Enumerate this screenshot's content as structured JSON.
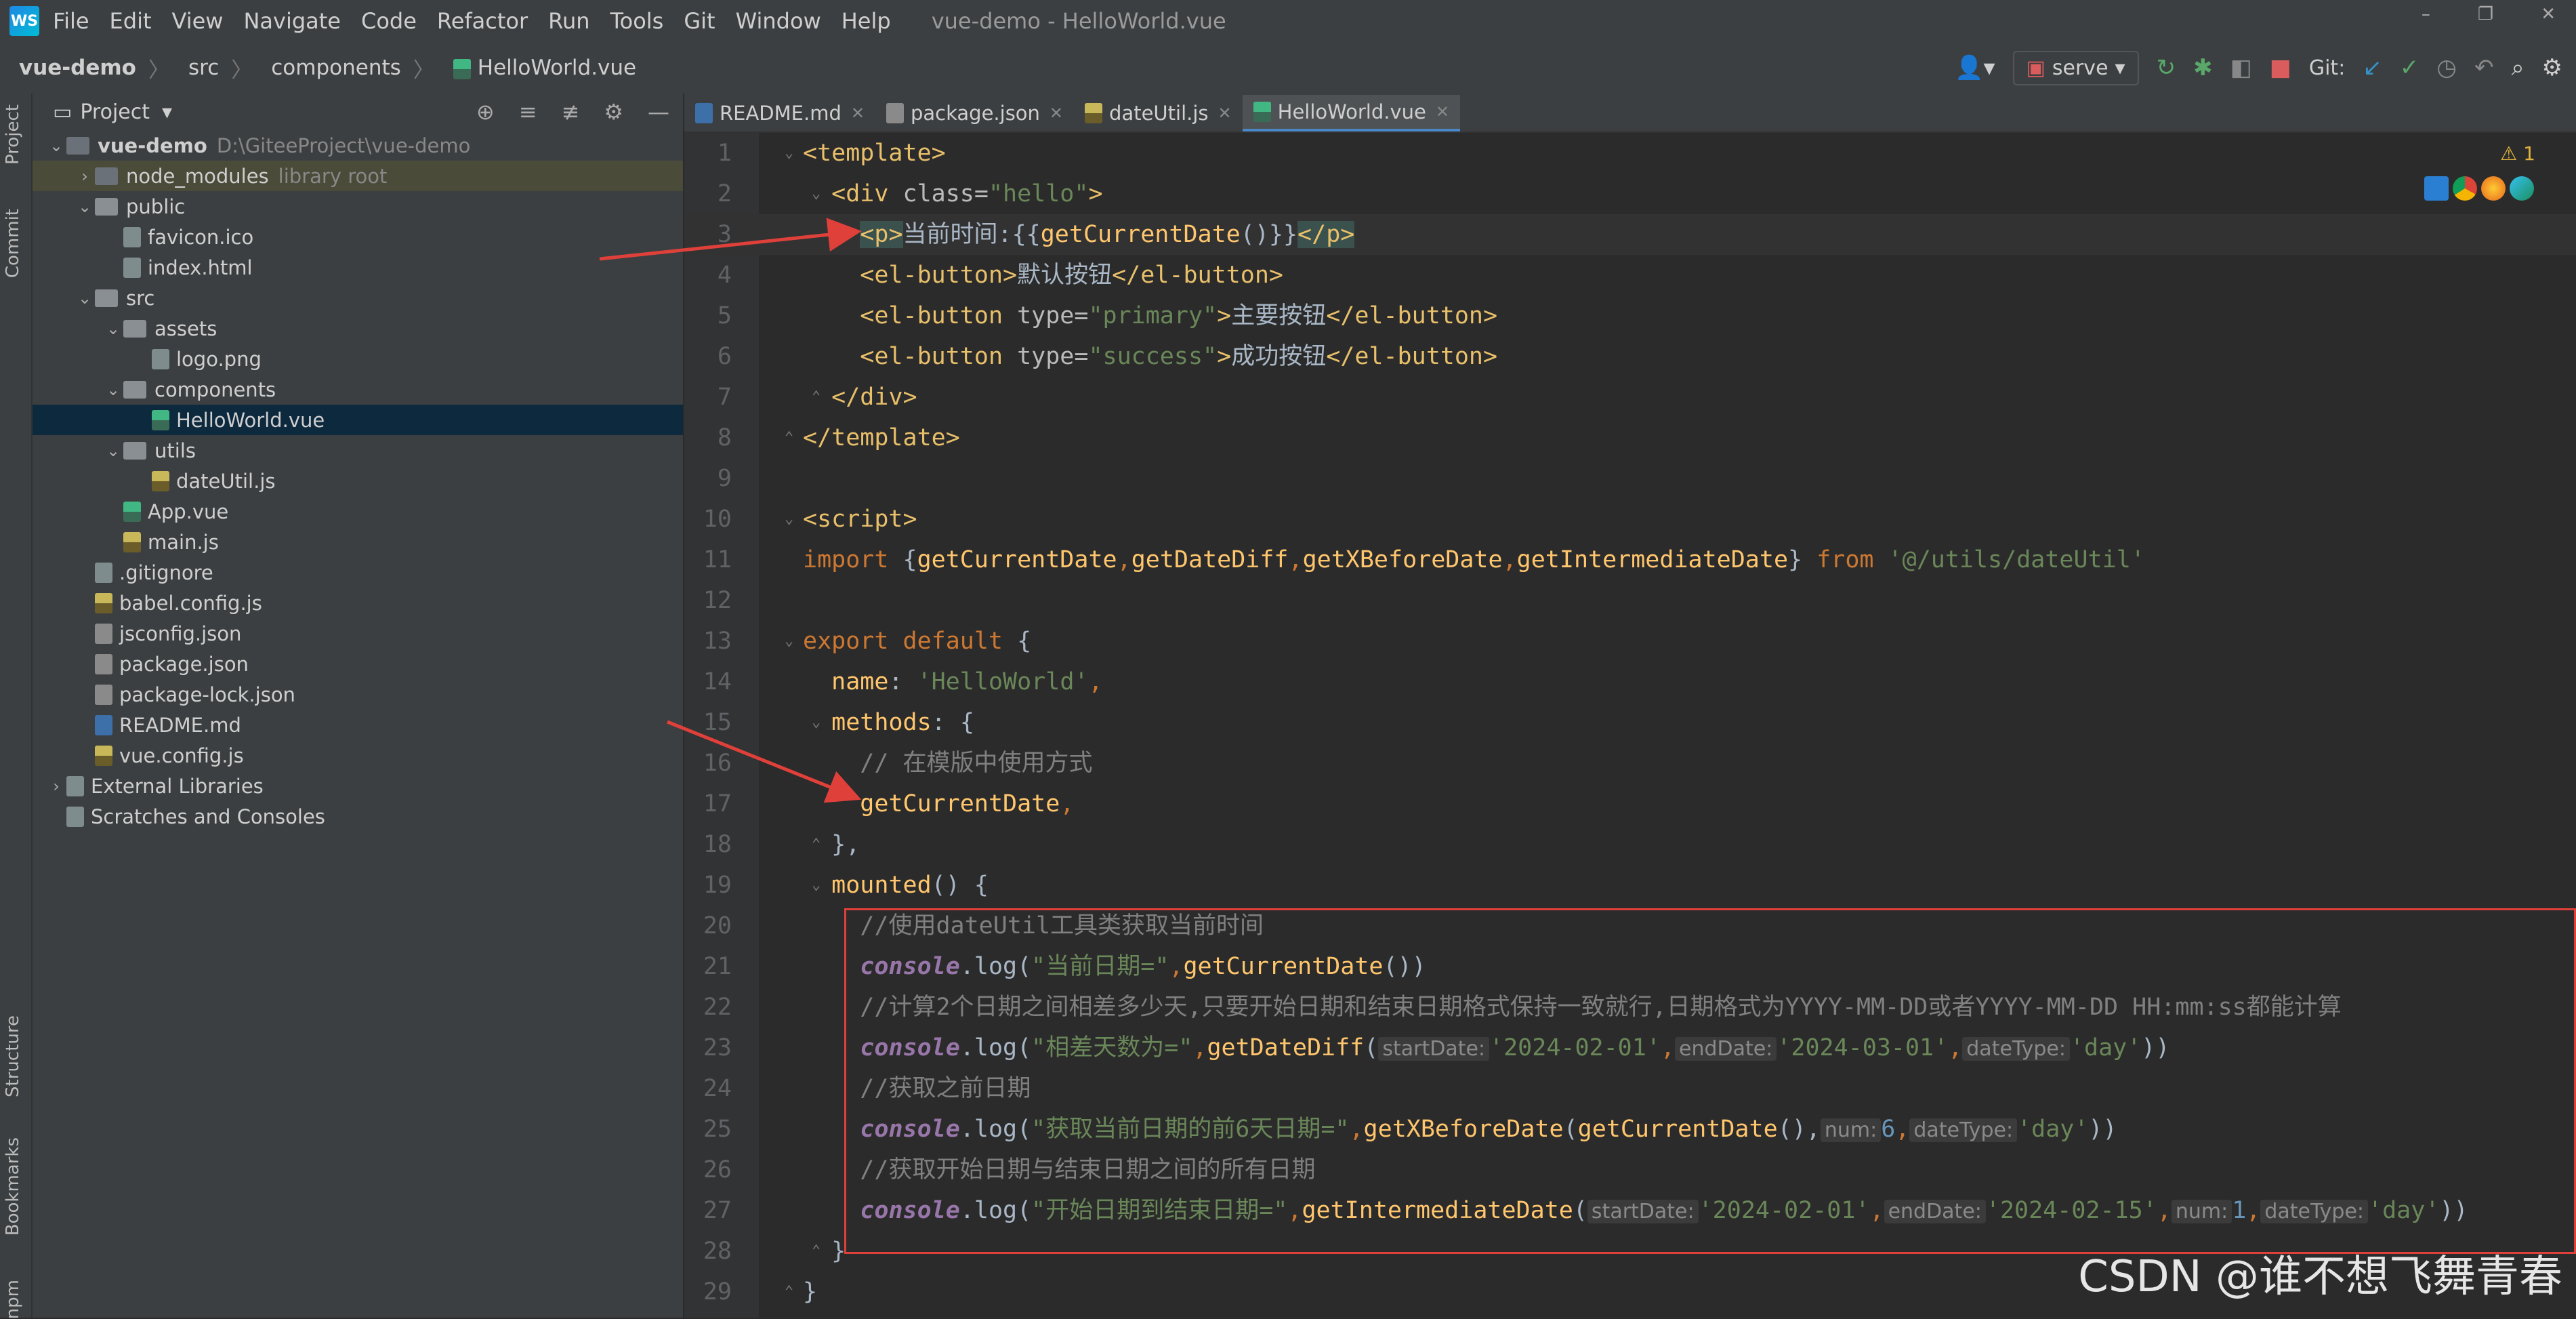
{
  "menubar": {
    "logo": "WS",
    "items": [
      "File",
      "Edit",
      "View",
      "Navigate",
      "Code",
      "Refactor",
      "Run",
      "Tools",
      "Git",
      "Window",
      "Help"
    ],
    "window_title": "vue-demo - HelloWorld.vue"
  },
  "breadcrumb": {
    "project": "vue-demo",
    "src": "src",
    "components": "components",
    "file": "HelloWorld.vue"
  },
  "toolbar": {
    "run_config": "serve",
    "git_label": "Git:"
  },
  "left_strip": {
    "project": "Project",
    "commit": "Commit",
    "structure": "Structure",
    "bookmarks": "Bookmarks",
    "npm": "npm"
  },
  "project_panel": {
    "title": "Project",
    "tree": [
      {
        "label": "vue-demo",
        "path": "D:\\GiteeProject\\vue-demo",
        "indent": 0,
        "arrow": "v",
        "type": "folder-dark",
        "bold": true
      },
      {
        "label": "node_modules",
        "path": "library root",
        "indent": 1,
        "arrow": ">",
        "type": "folder-dark"
      },
      {
        "label": "public",
        "indent": 1,
        "arrow": "v",
        "type": "folder"
      },
      {
        "label": "favicon.ico",
        "indent": 2,
        "type": "plain"
      },
      {
        "label": "index.html",
        "indent": 2,
        "type": "plain"
      },
      {
        "label": "src",
        "indent": 1,
        "arrow": "v",
        "type": "folder"
      },
      {
        "label": "assets",
        "indent": 2,
        "arrow": "v",
        "type": "folder"
      },
      {
        "label": "logo.png",
        "indent": 3,
        "type": "plain"
      },
      {
        "label": "components",
        "indent": 2,
        "arrow": "v",
        "type": "folder"
      },
      {
        "label": "HelloWorld.vue",
        "indent": 3,
        "type": "vue",
        "selected": true
      },
      {
        "label": "utils",
        "indent": 2,
        "arrow": "v",
        "type": "folder"
      },
      {
        "label": "dateUtil.js",
        "indent": 3,
        "type": "js"
      },
      {
        "label": "App.vue",
        "indent": 2,
        "type": "vue"
      },
      {
        "label": "main.js",
        "indent": 2,
        "type": "js"
      },
      {
        "label": ".gitignore",
        "indent": 1,
        "type": "plain"
      },
      {
        "label": "babel.config.js",
        "indent": 1,
        "type": "js"
      },
      {
        "label": "jsconfig.json",
        "indent": 1,
        "type": "json"
      },
      {
        "label": "package.json",
        "indent": 1,
        "type": "json"
      },
      {
        "label": "package-lock.json",
        "indent": 1,
        "type": "json"
      },
      {
        "label": "README.md",
        "indent": 1,
        "type": "md"
      },
      {
        "label": "vue.config.js",
        "indent": 1,
        "type": "js"
      },
      {
        "label": "External Libraries",
        "indent": 0,
        "arrow": ">",
        "type": "lib"
      },
      {
        "label": "Scratches and Consoles",
        "indent": 0,
        "arrow": "",
        "type": "lib"
      }
    ]
  },
  "tabs": [
    {
      "label": "README.md",
      "type": "md"
    },
    {
      "label": "package.json",
      "type": "json"
    },
    {
      "label": "dateUtil.js",
      "type": "js"
    },
    {
      "label": "HelloWorld.vue",
      "type": "vue",
      "active": true
    }
  ],
  "editor": {
    "warning": "⚠ 1",
    "line_numbers": [
      "1",
      "2",
      "3",
      "4",
      "5",
      "6",
      "7",
      "8",
      "9",
      "10",
      "11",
      "12",
      "13",
      "14",
      "15",
      "16",
      "17",
      "18",
      "19",
      "20",
      "21",
      "22",
      "23",
      "24",
      "25",
      "26",
      "27",
      "28",
      "29"
    ],
    "lines": {
      "l1": "<template>",
      "l2a": "<div ",
      "l2b": "class=",
      "l2c": "\"hello\"",
      "l2d": ">",
      "l3a": "<p>",
      "l3b": "当前时间:{{",
      "l3c": "getCurrentDate",
      "l3d": "()}}",
      "l3e": "</p>",
      "l4a": "<el-button>",
      "l4b": "默认按钮",
      "l4c": "</el-button>",
      "l5a": "<el-button ",
      "l5b": "type=",
      "l5c": "\"primary\"",
      "l5d": ">",
      "l5e": "主要按钮",
      "l5f": "</el-button>",
      "l6a": "<el-button ",
      "l6b": "type=",
      "l6c": "\"success\"",
      "l6d": ">",
      "l6e": "成功按钮",
      "l6f": "</el-button>",
      "l7": "</div>",
      "l8": "</template>",
      "l10": "<script>",
      "l11a": "import ",
      "l11b": "{",
      "l11c": "getCurrentDate",
      "l11d": ",",
      "l11e": "getDateDiff",
      "l11f": ",",
      "l11g": "getXBeforeDate",
      "l11h": ",",
      "l11i": "getIntermediateDate",
      "l11j": "} ",
      "l11k": "from ",
      "l11l": "'@/utils/dateUtil'",
      "l13a": "export default ",
      "l13b": "{",
      "l14a": "name",
      "l14b": ": ",
      "l14c": "'HelloWorld'",
      "l14d": ",",
      "l15a": "methods",
      "l15b": ": {",
      "l16": "// 在模版中使用方式",
      "l17a": "getCurrentDate",
      "l17b": ",",
      "l18": "},",
      "l19a": "mounted",
      "l19b": "() {",
      "l20": "//使用dateUtil工具类获取当前时间",
      "l21a": "console",
      "l21b": ".log(",
      "l21c": "\"当前日期=\"",
      "l21d": ",",
      "l21e": "getCurrentDate",
      "l21f": "())",
      "l22": "//计算2个日期之间相差多少天,只要开始日期和结束日期格式保持一致就行,日期格式为YYYY-MM-DD或者YYYY-MM-DD HH:mm:ss都能计算",
      "l23a": "console",
      "l23b": ".log(",
      "l23c": "\"相差天数为=\"",
      "l23d": ",",
      "l23e": "getDateDiff",
      "l23f": "(",
      "l23h1": "startDate:",
      "l23g": "'2024-02-01'",
      "l23i": ",",
      "l23h2": "endDate:",
      "l23j": "'2024-03-01'",
      "l23k": ",",
      "l23h3": "dateType:",
      "l23l": "'day'",
      "l23m": "))",
      "l24": "//获取之前日期",
      "l25a": "console",
      "l25b": ".log(",
      "l25c": "\"获取当前日期的前6天日期=\"",
      "l25d": ",",
      "l25e": "getXBeforeDate",
      "l25f": "(",
      "l25g": "getCurrentDate",
      "l25h": "(),",
      "l25i1": "num:",
      "l25j": "6",
      "l25k": ",",
      "l25i2": "dateType:",
      "l25l": "'day'",
      "l25m": "))",
      "l26": "//获取开始日期与结束日期之间的所有日期",
      "l27a": "console",
      "l27b": ".log(",
      "l27c": "\"开始日期到结束日期=\"",
      "l27d": ",",
      "l27e": "getIntermediateDate",
      "l27f": "(",
      "l27h1": "startDate:",
      "l27g": "'2024-02-01'",
      "l27i": ",",
      "l27h2": "endDate:",
      "l27j": "'2024-02-15'",
      "l27k": ",",
      "l27h3": "num:",
      "l27l": "1",
      "l27m": ",",
      "l27h4": "dateType:",
      "l27n": "'day'",
      "l27o": "))",
      "l28": "}",
      "l29": "}"
    }
  },
  "watermark": "CSDN @谁不想飞舞青春",
  "colors": {
    "accent": "#4a88c7",
    "annotation_red": "#e0403a"
  }
}
